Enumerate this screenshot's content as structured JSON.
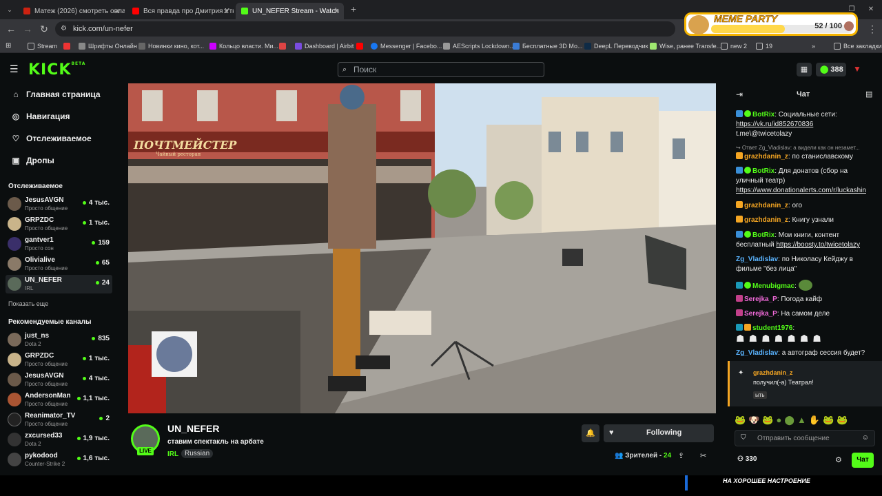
{
  "browser": {
    "tabs": [
      {
        "title": "Матеж (2026) смотреть онлай",
        "favicon_color": "#d12"
      },
      {
        "title": "Вся правда про Дмитрия Утк",
        "favicon_color": "#f00"
      },
      {
        "title": "UN_NEFER Stream - Watch",
        "favicon_color": "#53fc18"
      }
    ],
    "new_tab": "+",
    "url": "kick.com/un-nefer",
    "bookmarks": [
      "Stream",
      "",
      "Шрифты Онлайн",
      "Новинки кино, кот...",
      "Кольцо власти. Ми...",
      "",
      "Dashboard | Airbit",
      "",
      "Messenger | Facebo...",
      "AEScripts Lockdown...",
      "Бесплатные 3D Мо...",
      "DeepL Переводчик",
      "Wise, ранее Transfe...",
      "new 2",
      "19"
    ],
    "all_bookmarks": "Все закладки"
  },
  "overlay": {
    "title": "MEME PARTY",
    "score": "52 / 100",
    "progress": 0.52
  },
  "kick": {
    "logo": "KICK",
    "logo_sup": "BETA",
    "search_placeholder": "Поиск",
    "points": "388"
  },
  "sidebar": {
    "nav": [
      "Главная страница",
      "Навигация",
      "Отслеживаемое",
      "Дропы"
    ],
    "following_header": "Отслеживаемое",
    "following": [
      {
        "name": "JesusAVGN",
        "category": "Просто общение",
        "viewers": "4 тыс."
      },
      {
        "name": "GRPZDC",
        "category": "Просто общение",
        "viewers": "1 тыс."
      },
      {
        "name": "gantver1",
        "category": "Просто сон",
        "viewers": "159"
      },
      {
        "name": "Olivialive",
        "category": "Просто общение",
        "viewers": "65"
      },
      {
        "name": "UN_NEFER",
        "category": "IRL",
        "viewers": "24"
      }
    ],
    "show_more": "Показать еще",
    "recommended_header": "Рекомендуемые каналы",
    "recommended": [
      {
        "name": "just_ns",
        "category": "Dota 2",
        "viewers": "835"
      },
      {
        "name": "GRPZDC",
        "category": "Просто общение",
        "viewers": "1 тыс."
      },
      {
        "name": "JesusAVGN",
        "category": "Просто общение",
        "viewers": "4 тыс."
      },
      {
        "name": "AndersonMan",
        "category": "Просто общение",
        "viewers": "1,1 тыс."
      },
      {
        "name": "Reanimator_TV",
        "category": "Просто общение",
        "viewers": "2"
      },
      {
        "name": "zxcursed33",
        "category": "Dota 2",
        "viewers": "1,9 тыс."
      },
      {
        "name": "pykodood",
        "category": "Counter-Strike 2",
        "viewers": "1,6 тыс."
      }
    ]
  },
  "stream": {
    "sign_text": "ПОЧТМЕЙСТЕР",
    "sign_sub": "Чайный ресторан",
    "channel": "UN_NEFER",
    "title": "ставим спектакль на арбате",
    "category": "IRL",
    "language": "Russian",
    "live": "LIVE",
    "follow_label": "Following",
    "viewers_label": "Зрителей",
    "viewers": "24"
  },
  "chat": {
    "title": "Чат",
    "messages": [
      {
        "user": "BotRix",
        "color": "#53fc18",
        "text": "Социальные сети:",
        "link": "https://vk.ru/id852670836",
        "extra": "t.me\\@twicetolazy"
      },
      {
        "reply": "↪ Ответ Zg_Vladislav: а видели как он незамет..."
      },
      {
        "user": "grazhdanin_z",
        "color": "#f5a623",
        "text": "по станиславскому"
      },
      {
        "user": "BotRix",
        "color": "#53fc18",
        "text": "Для донатов (сбор на уличный театр)",
        "link": "https://www.donationalerts.com/r/luckashin"
      },
      {
        "user": "grazhdanin_z",
        "color": "#f5a623",
        "text": "ого"
      },
      {
        "user": "grazhdanin_z",
        "color": "#f5a623",
        "text": "Книгу узнали"
      },
      {
        "user": "BotRix",
        "color": "#53fc18",
        "text": "Мои книги, контент бесплатный",
        "link": "https://boosty.to/twicetolazy"
      },
      {
        "user": "Zg_Vladislav",
        "color": "#5ab4ff",
        "text": "по Николасу Кейджу в фильме \"без лица\""
      },
      {
        "user": "Menubigmac",
        "color": "#53fc18",
        "text": ""
      },
      {
        "user": "Serejka_P",
        "color": "#f06ad9",
        "text": "Погода кайф"
      },
      {
        "user": "Serejka_P",
        "color": "#f06ad9",
        "text": "На самом деле"
      },
      {
        "user": "student1976",
        "color": "#53fc18",
        "text": ""
      },
      {
        "user": "Zg_Vladislav",
        "color": "#5ab4ff",
        "text": "а автограф сессия будет?"
      }
    ],
    "gift_user": "grazhdanin_z",
    "gift_text": "получил(-а) Театрал!",
    "gift_badge": "ыть",
    "input_placeholder": "Отправить сообщение",
    "points": "330",
    "send_label": "Чат"
  },
  "ticker": "НА ХОРОШЕЕ НАСТРОЕНИЕ"
}
